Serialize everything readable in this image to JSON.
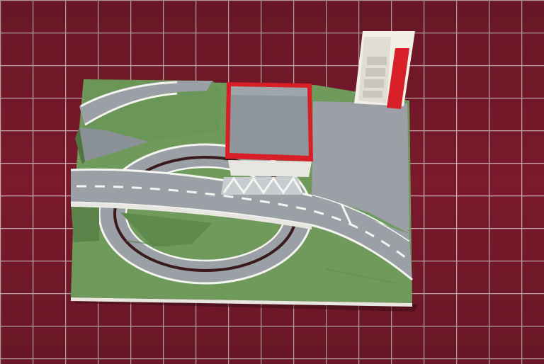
{
  "photo": {
    "subject": "model-race-track-diorama",
    "colors": {
      "mat": "#7a1a2c",
      "mat_grid": "#d9c8cc",
      "grass": "#6f9a5c",
      "grass_dark": "#5a8249",
      "road": "#9aa0a6",
      "road_dark": "#808890",
      "road_line": "#f4f4f0",
      "building_red": "#d81e26",
      "building_roof": "#8e959b",
      "slot": "#3a1a1c",
      "base_edge": "#e8e6e0",
      "stand_white": "#f1efe6"
    }
  }
}
